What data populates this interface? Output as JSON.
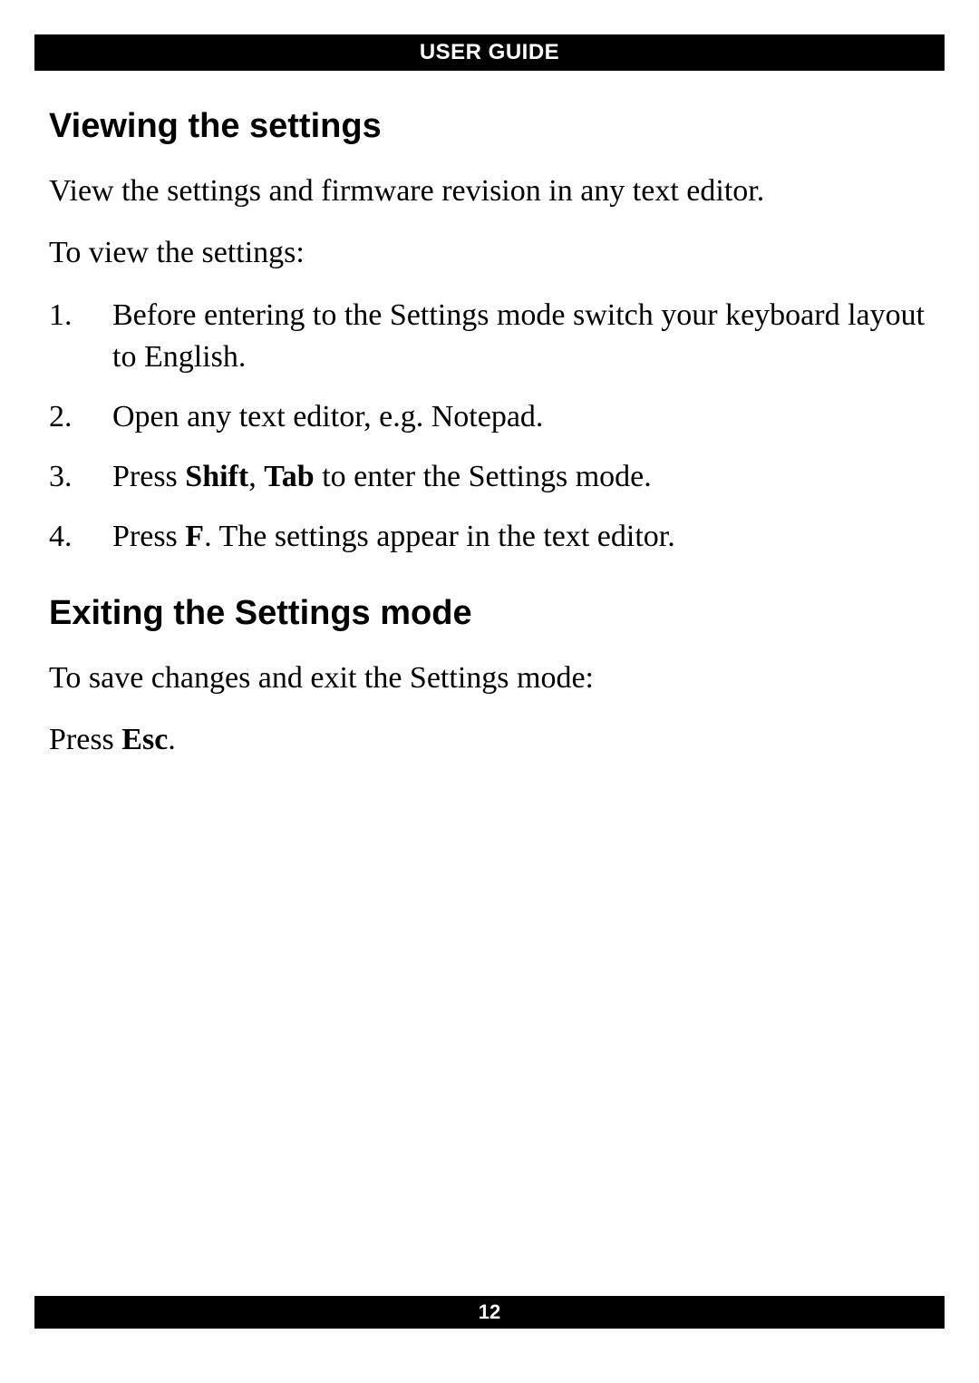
{
  "header": {
    "title": "USER GUIDE"
  },
  "section1": {
    "heading": "Viewing the settings",
    "intro": "View the settings and firmware revision in any text editor.",
    "lead": "To view the settings:",
    "steps": {
      "s1": {
        "num": "1.",
        "text": "Before entering to the Settings mode switch your keyboard layout to English."
      },
      "s2": {
        "num": "2.",
        "text": "Open any text editor, e.g. Notepad."
      },
      "s3": {
        "num": "3.",
        "pre": "Press ",
        "key1": "Shift",
        "mid": ", ",
        "key2": "Tab",
        "post": " to enter the Settings mode."
      },
      "s4": {
        "num": "4.",
        "pre": "Press ",
        "key1": "F",
        "post": ". The settings appear in the text editor."
      }
    }
  },
  "section2": {
    "heading": "Exiting the Settings mode",
    "intro": "To save changes and exit the Settings mode:",
    "action_pre": "Press ",
    "action_key": "Esc",
    "action_post": "."
  },
  "footer": {
    "page_number": "12"
  }
}
